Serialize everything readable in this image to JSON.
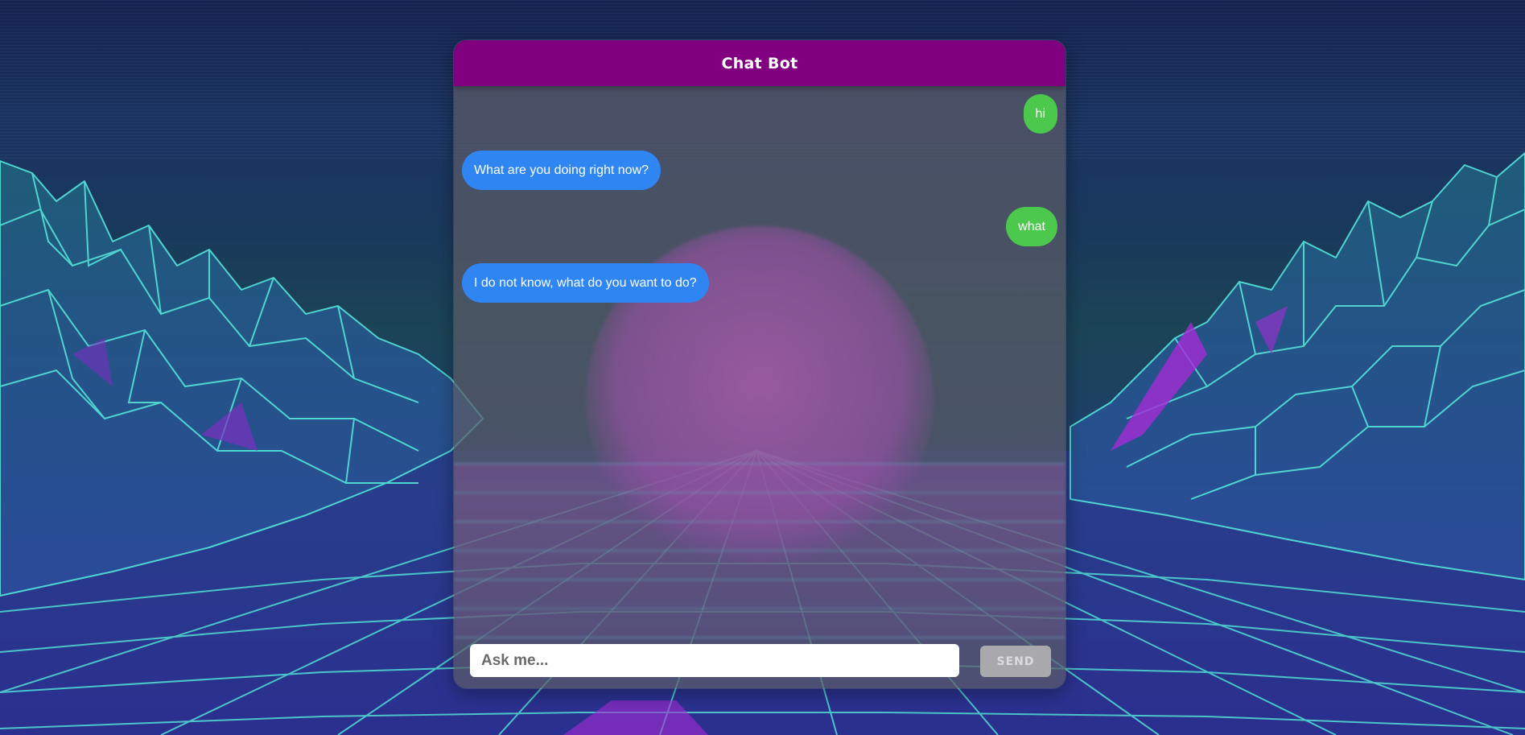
{
  "chat": {
    "title": "Chat Bot",
    "messages": [
      {
        "from": "user",
        "text": "hi"
      },
      {
        "from": "bot",
        "text": "What are you doing right now?"
      },
      {
        "from": "user",
        "text": "what"
      },
      {
        "from": "bot",
        "text": "I do not know, what do you want to do?"
      }
    ],
    "input": {
      "value": "",
      "placeholder": "Ask me..."
    },
    "send_label": "SEND"
  },
  "colors": {
    "header": "#800080",
    "user_bubble": "#4cc94c",
    "bot_bubble": "#2f86f3",
    "send_button": "#a9a9ad",
    "grid_lines": "#4fd4d0",
    "mountain_accent": "#a52bd6"
  },
  "background": {
    "theme": "synthwave wireframe mountains with grid floor and purple sun"
  }
}
